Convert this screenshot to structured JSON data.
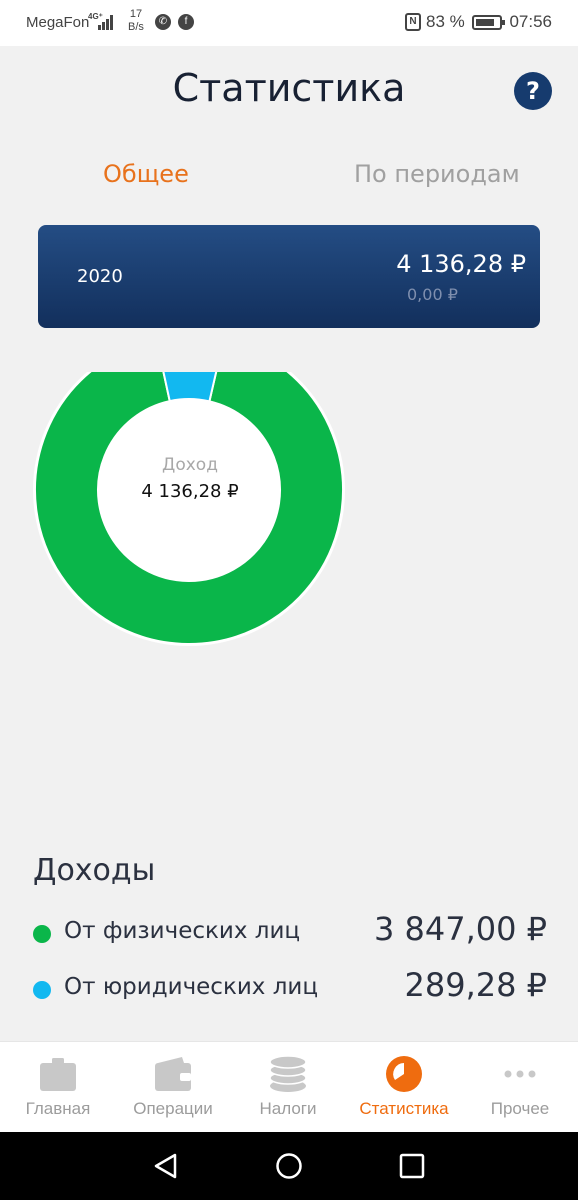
{
  "status_bar": {
    "carrier": "MegaFon",
    "network": "4G⁺",
    "speed_value": "17",
    "speed_unit": "B/s",
    "phone_icon": "phone-icon",
    "facebook_icon": "facebook-icon",
    "nfc": "N",
    "battery_text": "83 %",
    "battery_level": 0.83,
    "time": "07:56"
  },
  "header": {
    "title": "Статистика",
    "help_label": "?"
  },
  "tabs": [
    {
      "label": "Общее",
      "active": true
    },
    {
      "label": "По периодам",
      "active": false
    }
  ],
  "year_card": {
    "year": "2020",
    "income": "4 136,28 ₽",
    "secondary": "0,00 ₽"
  },
  "chart_data": {
    "type": "pie",
    "center_caption": "Доход",
    "center_value": "4 136,28 ₽",
    "slices": [
      {
        "label": "От физических лиц",
        "value": 3847.0,
        "color": "#0ab64a"
      },
      {
        "label": "От юридических лиц",
        "value": 289.28,
        "color": "#12b8f0"
      }
    ]
  },
  "income": {
    "title": "Доходы",
    "rows": [
      {
        "label": "От физических лиц",
        "amount": "3 847,00 ₽",
        "color": "#0ab64a"
      },
      {
        "label": "От юридических лиц",
        "amount": "289,28 ₽",
        "color": "#12b8f0"
      }
    ]
  },
  "bottom_nav": [
    {
      "label": "Главная",
      "icon": "briefcase-icon",
      "active": false
    },
    {
      "label": "Операции",
      "icon": "wallet-icon",
      "active": false
    },
    {
      "label": "Налоги",
      "icon": "coins-icon",
      "active": false
    },
    {
      "label": "Статистика",
      "icon": "pie-chart-icon",
      "active": true
    },
    {
      "label": "Прочее",
      "icon": "more-icon",
      "active": false
    }
  ],
  "system_nav": {
    "back_icon": "back-icon",
    "home_icon": "home-icon",
    "recents_icon": "recents-icon"
  }
}
